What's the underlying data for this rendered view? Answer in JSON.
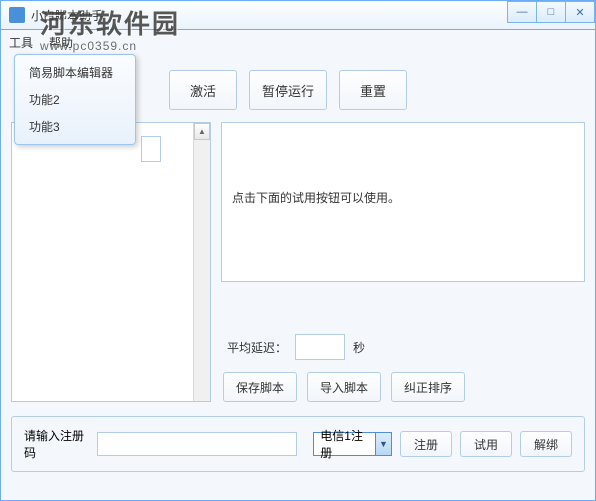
{
  "window": {
    "title": "小白脚本助手"
  },
  "watermark": {
    "main": "河东软件园",
    "sub": "www.pc0359.cn"
  },
  "menubar": {
    "tools": "工具",
    "help": "帮助"
  },
  "dropdown": {
    "items": [
      "简易脚本编辑器",
      "功能2",
      "功能3"
    ]
  },
  "top_buttons": {
    "activate": "激活",
    "pause": "暂停运行",
    "reset": "重置"
  },
  "right_panel": {
    "hint": "点击下面的试用按钮可以使用。"
  },
  "delay": {
    "label": "平均延迟：",
    "value": "",
    "unit": "秒"
  },
  "script_buttons": {
    "save": "保存脚本",
    "import": "导入脚本",
    "fix": "纠正排序"
  },
  "bottom": {
    "label": "请输入注册码",
    "reg_value": "",
    "combo_selected": "电信1注册",
    "btn_register": "注册",
    "btn_trial": "试用",
    "btn_unbind": "解绑"
  }
}
